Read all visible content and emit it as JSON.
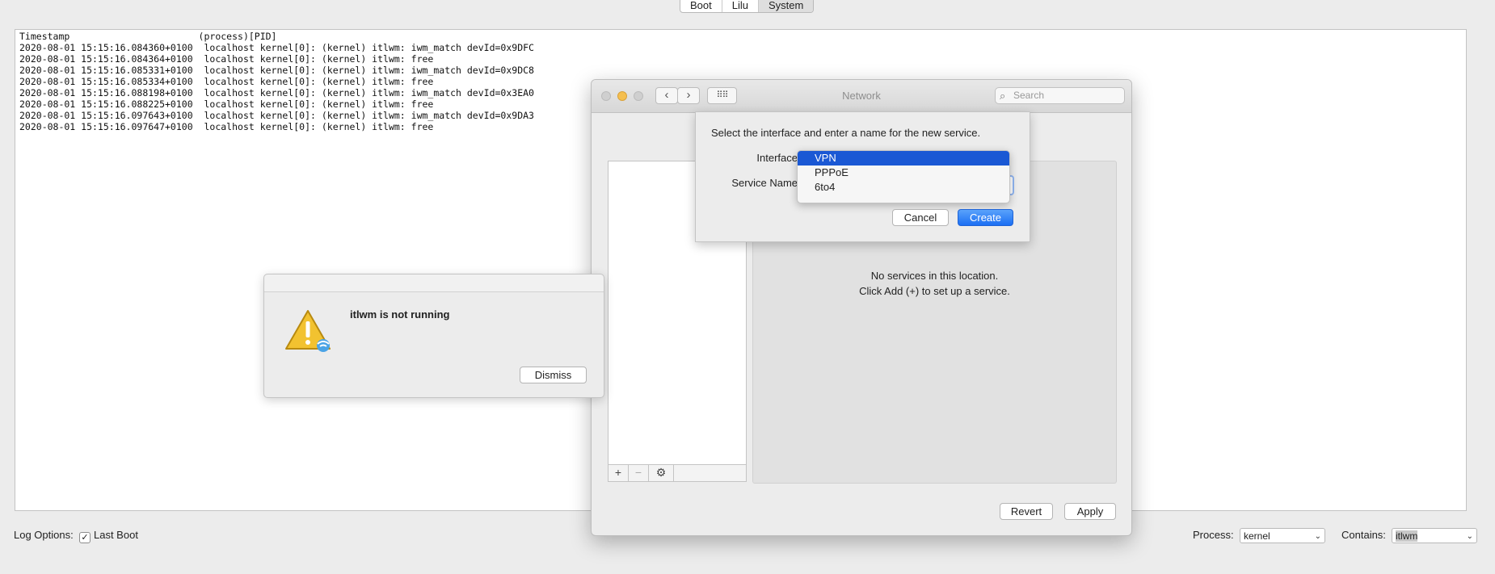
{
  "top_segments": [
    "Boot",
    "Lilu",
    "System"
  ],
  "log": {
    "header": "Timestamp                       (process)[PID]",
    "lines": [
      "2020-08-01 15:15:16.084360+0100  localhost kernel[0]: (kernel) itlwm: iwm_match devId=0x9DFC",
      "2020-08-01 15:15:16.084364+0100  localhost kernel[0]: (kernel) itlwm: free",
      "2020-08-01 15:15:16.085331+0100  localhost kernel[0]: (kernel) itlwm: iwm_match devId=0x9DC8",
      "2020-08-01 15:15:16.085334+0100  localhost kernel[0]: (kernel) itlwm: free",
      "2020-08-01 15:15:16.088198+0100  localhost kernel[0]: (kernel) itlwm: iwm_match devId=0x3EA0",
      "2020-08-01 15:15:16.088225+0100  localhost kernel[0]: (kernel) itlwm: free",
      "2020-08-01 15:15:16.097643+0100  localhost kernel[0]: (kernel) itlwm: iwm_match devId=0x9DA3",
      "2020-08-01 15:15:16.097647+0100  localhost kernel[0]: (kernel) itlwm: free"
    ]
  },
  "bottom": {
    "log_options_label": "Log Options:",
    "last_boot_label": "Last Boot",
    "last_boot_checked": "✓",
    "process_label": "Process:",
    "process_value": "kernel",
    "contains_label": "Contains:",
    "contains_value": "itlwm"
  },
  "alert": {
    "message": "itlwm is not running",
    "dismiss": "Dismiss"
  },
  "network": {
    "title": "Network",
    "search_placeholder": "Search",
    "empty_line1": "No services in this location.",
    "empty_line2": "Click Add (+) to set up a service.",
    "revert": "Revert",
    "apply": "Apply",
    "add": "+",
    "remove": "−",
    "gear": "⚙"
  },
  "sheet": {
    "prompt": "Select the interface and enter a name for the new service.",
    "interface_label": "Interface",
    "service_name_label": "Service Name",
    "options": [
      "VPN",
      "PPPoE",
      "6to4"
    ],
    "cancel": "Cancel",
    "create": "Create"
  },
  "colors": {
    "accent": "#1a58d4",
    "close": "#cfcfcf",
    "minimize": "#f5bf4f"
  }
}
